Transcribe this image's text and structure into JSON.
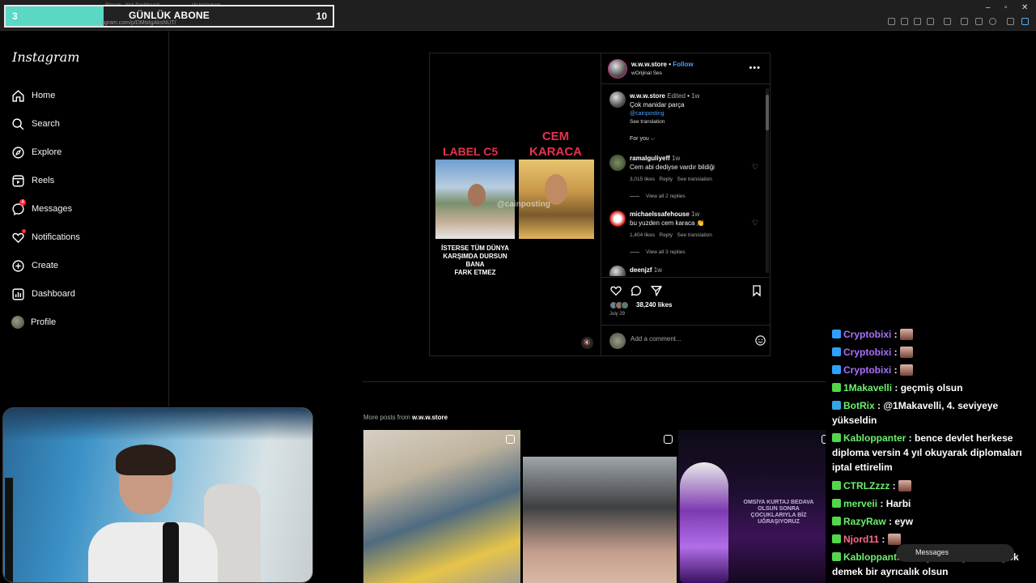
{
  "browser": {
    "address_url": "agram.com/p/DMsiIgAksNUT/",
    "tabs": [
      "Stream - Yick Dashboard",
      "(4) Instagram"
    ]
  },
  "overlay": {
    "sub_goal": {
      "current": "3",
      "title": "GÜNLÜK ABONE",
      "target": "10",
      "progress": 0.3
    }
  },
  "sidebar": {
    "logo": "Instagram",
    "items": [
      {
        "label": "Home",
        "icon": "home-icon"
      },
      {
        "label": "Search",
        "icon": "search-icon"
      },
      {
        "label": "Explore",
        "icon": "compass-icon"
      },
      {
        "label": "Reels",
        "icon": "reels-icon"
      },
      {
        "label": "Messages",
        "icon": "messenger-icon",
        "badge": "4"
      },
      {
        "label": "Notifications",
        "icon": "heart-icon"
      },
      {
        "label": "Create",
        "icon": "plus-square-icon"
      },
      {
        "label": "Dashboard",
        "icon": "dashboard-icon"
      },
      {
        "label": "Profile",
        "icon": "avatar-icon"
      }
    ]
  },
  "post": {
    "media": {
      "label_left": "LABEL C5",
      "label_right_line1": "CEM",
      "label_right_line2": "KARACA",
      "watermark": "@cainposting",
      "caption_line1": "İSTERSE TÜM DÜNYA",
      "caption_line2": "KARŞIMDA DURSUN BANA",
      "caption_line3": "FARK ETMEZ"
    },
    "author": "w.w.w.store",
    "follow": "Follow",
    "audio": "wOrijinal Ses",
    "caption": {
      "author": "w.w.w.store",
      "edited": "Edited",
      "time": "1w",
      "text": "Çok manidar parça",
      "mention": "@cainposting",
      "see_translation": "See translation"
    },
    "sort_label": "For you",
    "comments": [
      {
        "user": "ramalguliyeff",
        "time": "1w",
        "text": "Cem abi dediyse vardır bildiği",
        "likes": "3,015 likes",
        "reply": "Reply",
        "translate": "See translation",
        "view_replies": "View all 2 replies"
      },
      {
        "user": "michaelssafehouse",
        "time": "1w",
        "text": "bu yuzden cem karaca 👏",
        "likes": "1,404 likes",
        "reply": "Reply",
        "translate": "See translation",
        "view_replies": "View all 3 replies"
      },
      {
        "user": "deenjzf",
        "time": "1w"
      }
    ],
    "likes": "38,240 likes",
    "date": "July 29",
    "comment_placeholder": "Add a comment..."
  },
  "more_posts": {
    "prefix": "More posts from",
    "account": "w.w.w.store",
    "thumb3_text": "OMSİYA KURTAJ BEDAVA OLSUN SONRA ÇOCUKLARIYLA BİZ UĞRAŞIYORUZ"
  },
  "chat": {
    "messages": [
      {
        "user": "Cryptobixi",
        "color": "#a970ff",
        "text": ""
      },
      {
        "user": "Cryptobixi",
        "color": "#a970ff",
        "text": ""
      },
      {
        "user": "Cryptobixi",
        "color": "#a970ff",
        "text": ""
      },
      {
        "user": "1Makavelli",
        "color": "#6cf06c",
        "text": "geçmiş olsun"
      },
      {
        "user": "BotRix",
        "color": "#6cf06c",
        "text": "@1Makavelli, 4. seviyeye yükseldin"
      },
      {
        "user": "Kabloppanter",
        "color": "#6cf06c",
        "text": "bence devlet herkese diploma versin 4 yıl okuyarak diplomaları iptal ettirelim"
      },
      {
        "user": "CTRLZzzz",
        "color": "#6cf06c",
        "text": ""
      },
      {
        "user": "merveii",
        "color": "#6cf06c",
        "text": "Harbi"
      },
      {
        "user": "RazyRaw",
        "color": "#6cf06c",
        "text": "eyw"
      },
      {
        "user": "Njord11",
        "color": "#ff6b8b",
        "text": ""
      },
      {
        "user": "Kabloppanter",
        "color": "#6cf06c",
        "text": "böylece diplomam yok demek bir ayrıcalık olsun"
      }
    ],
    "messages_pill": "Messages"
  }
}
